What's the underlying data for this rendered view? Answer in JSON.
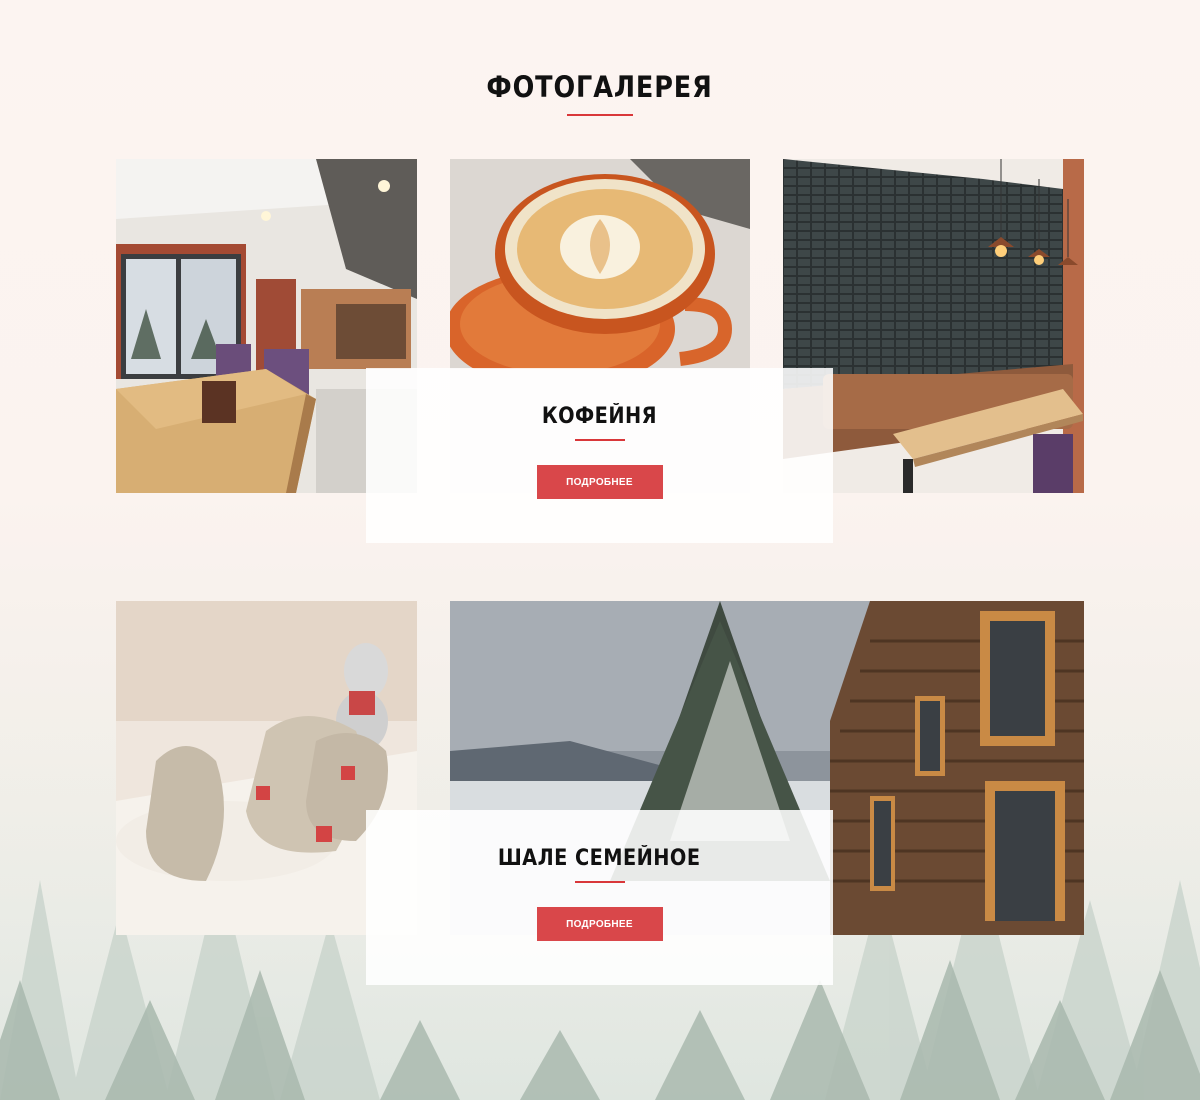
{
  "gallery": {
    "title": "ФОТОГАЛЕРЕЯ",
    "accent_color": "#d9373a",
    "button_color": "#d9474a",
    "rows": [
      {
        "photos": [
          "restaurant-interior-photo",
          "latte-art-coffee-photo",
          "brick-wall-dining-photo"
        ],
        "card": {
          "title": "КОФЕЙНЯ",
          "button_label": "ПОДРОБНЕЕ"
        }
      },
      {
        "photos": [
          "linen-gift-bags-photo",
          "snowy-chalet-photo"
        ],
        "card": {
          "title": "ШАЛЕ СЕМЕЙНОЕ",
          "button_label": "ПОДРОБНЕЕ"
        }
      }
    ]
  }
}
